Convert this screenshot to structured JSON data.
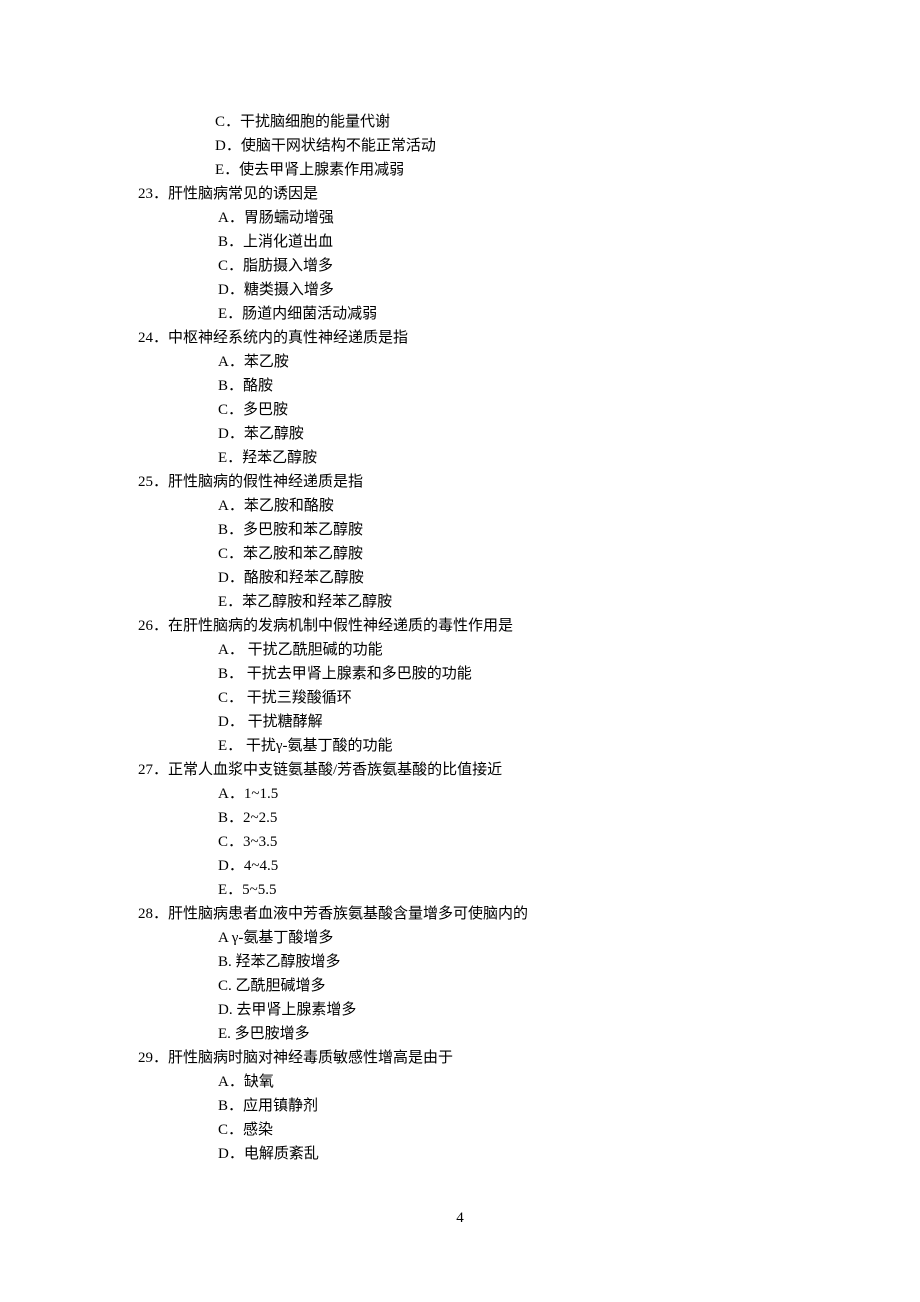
{
  "orphan_options": [
    "C．干扰脑细胞的能量代谢",
    "D．使脑干网状结构不能正常活动",
    "E．使去甲肾上腺素作用减弱"
  ],
  "questions": [
    {
      "num": "23",
      "text": "肝性脑病常见的诱因是",
      "options": [
        "A．胃肠蠕动增强",
        "B．上消化道出血",
        "C．脂肪摄入增多",
        "D．糖类摄入增多",
        "E．肠道内细菌活动减弱"
      ]
    },
    {
      "num": "24",
      "text": "中枢神经系统内的真性神经递质是指",
      "options": [
        "A．苯乙胺",
        "B．酪胺",
        "C．多巴胺",
        "D．苯乙醇胺",
        "E．羟苯乙醇胺"
      ]
    },
    {
      "num": "25",
      "text": "肝性脑病的假性神经递质是指",
      "options": [
        "A．苯乙胺和酪胺",
        "B．多巴胺和苯乙醇胺",
        "C．苯乙胺和苯乙醇胺",
        "D．酪胺和羟苯乙醇胺",
        "E．苯乙醇胺和羟苯乙醇胺"
      ]
    },
    {
      "num": "26",
      "text": "在肝性脑病的发病机制中假性神经递质的毒性作用是",
      "options": [
        "A．  干扰乙酰胆碱的功能",
        "B．  干扰去甲肾上腺素和多巴胺的功能",
        "C．  干扰三羧酸循环",
        "D．  干扰糖酵解",
        "E．  干扰γ-氨基丁酸的功能"
      ]
    },
    {
      "num": "27",
      "text": "正常人血浆中支链氨基酸/芳香族氨基酸的比值接近",
      "options": [
        "A．1~1.5",
        "B．2~2.5",
        "C．3~3.5",
        "D．4~4.5",
        "E．5~5.5"
      ]
    },
    {
      "num": "28",
      "text": "肝性脑病患者血液中芳香族氨基酸含量增多可使脑内的",
      "options": [
        "A γ-氨基丁酸增多",
        "B. 羟苯乙醇胺增多",
        "C. 乙酰胆碱增多",
        "D. 去甲肾上腺素增多",
        "E. 多巴胺增多"
      ]
    },
    {
      "num": "29",
      "text": "肝性脑病时脑对神经毒质敏感性增高是由于",
      "options": [
        "A．缺氧",
        "B．应用镇静剂",
        "C．感染",
        "D．电解质紊乱"
      ]
    }
  ],
  "page_number": "4"
}
